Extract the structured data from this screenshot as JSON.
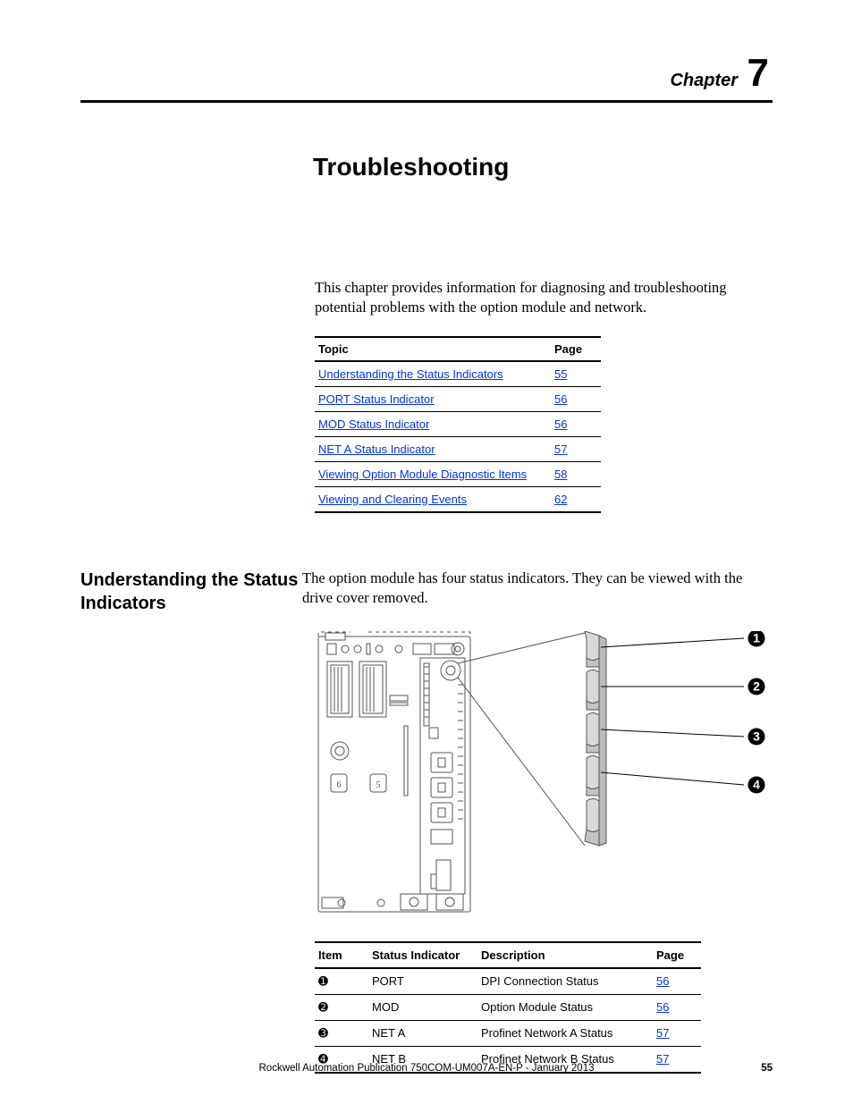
{
  "chapter": {
    "label": "Chapter",
    "number": "7"
  },
  "title": "Troubleshooting",
  "intro": "This chapter provides information for diagnosing and troubleshooting potential problems with the option module and network.",
  "topic_table": {
    "headers": {
      "topic": "Topic",
      "page": "Page"
    },
    "rows": [
      {
        "topic": "Understanding the Status Indicators",
        "page": "55"
      },
      {
        "topic": "PORT Status Indicator",
        "page": "56"
      },
      {
        "topic": "MOD Status Indicator",
        "page": "56"
      },
      {
        "topic": "NET A Status Indicator",
        "page": "57"
      },
      {
        "topic": "Viewing Option Module Diagnostic Items",
        "page": "58"
      },
      {
        "topic": "Viewing and Clearing Events",
        "page": "62"
      }
    ]
  },
  "section1": {
    "heading": "Understanding the Status Indicators",
    "body": "The option module has four status indicators. They can be viewed with the drive cover removed."
  },
  "callouts": [
    "1",
    "2",
    "3",
    "4"
  ],
  "status_table": {
    "headers": {
      "item": "Item",
      "si": "Status Indicator",
      "desc": "Description",
      "page": "Page"
    },
    "rows": [
      {
        "item": "➊",
        "si": "PORT",
        "desc": "DPI Connection Status",
        "page": "56"
      },
      {
        "item": "➋",
        "si": "MOD",
        "desc": "Option Module Status",
        "page": "56"
      },
      {
        "item": "➌",
        "si": "NET A",
        "desc": "Profinet Network A Status",
        "page": "57"
      },
      {
        "item": "➍",
        "si": "NET B",
        "desc": "Profinet Network B Status",
        "page": "57"
      }
    ]
  },
  "footer": {
    "publication": "Rockwell Automation Publication 750COM-UM007A-EN-P - January 2013",
    "page_number": "55"
  }
}
